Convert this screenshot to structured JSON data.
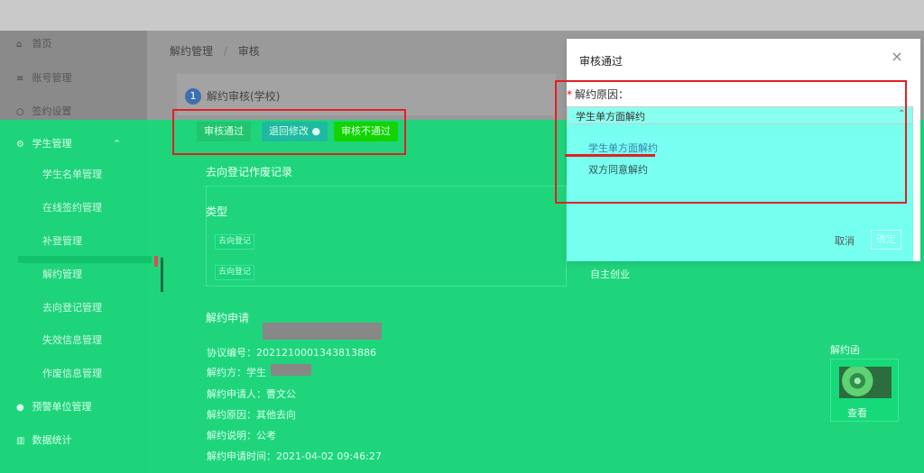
{
  "sidebar": {
    "items": [
      {
        "icon": "home-icon",
        "label": "首页"
      },
      {
        "icon": "menu-icon",
        "label": "账号管理"
      },
      {
        "icon": "settings-icon",
        "label": "签约设置"
      },
      {
        "icon": "student-icon",
        "label": "学生管理"
      },
      {
        "label": "学生名单管理"
      },
      {
        "label": "在线签约管理"
      },
      {
        "label": "补登管理"
      },
      {
        "label": "解约管理"
      },
      {
        "label": "去向登记管理"
      },
      {
        "label": "失效信息管理"
      },
      {
        "label": "作废信息管理"
      },
      {
        "icon": "alert-icon",
        "label": "预警单位管理"
      },
      {
        "icon": "stats-icon",
        "label": "数据统计"
      }
    ]
  },
  "header": {
    "breadcrumb": {
      "root": "解约管理",
      "separator": "/",
      "current": "审核"
    }
  },
  "step": {
    "number": "1",
    "title": "解约审核(学校)"
  },
  "actions": {
    "approve": "审核通过",
    "return": "退回修改",
    "reject": "审核不通过"
  },
  "record": {
    "title": "去向登记作废记录",
    "column_type": "类型",
    "rows": [
      "去向登记",
      "去向登记"
    ],
    "right_text": "自主创业"
  },
  "application": {
    "title": "解约申请",
    "agreement_no": "协议编号：2021210001343813886",
    "party": "解约方：学生",
    "applicant": "解约申请人：曹文公",
    "reason": "解约原因：其他去向",
    "note": "解约说明：公考",
    "time": "解约申请时间：2021-04-02 09:46:27",
    "letter_label": "解约函",
    "view_link": "查看"
  },
  "modal": {
    "title": "审核通过",
    "close": "×",
    "field_label": "解约原因：",
    "selected_value": "学生单方面解约",
    "options": [
      "学生单方面解约",
      "双方同意解约"
    ],
    "cancel": "取消",
    "confirm": "确定"
  },
  "colors": {
    "overlay": "#16d97a",
    "accent": "#3d6fb0",
    "red_box": "#e21f26"
  }
}
